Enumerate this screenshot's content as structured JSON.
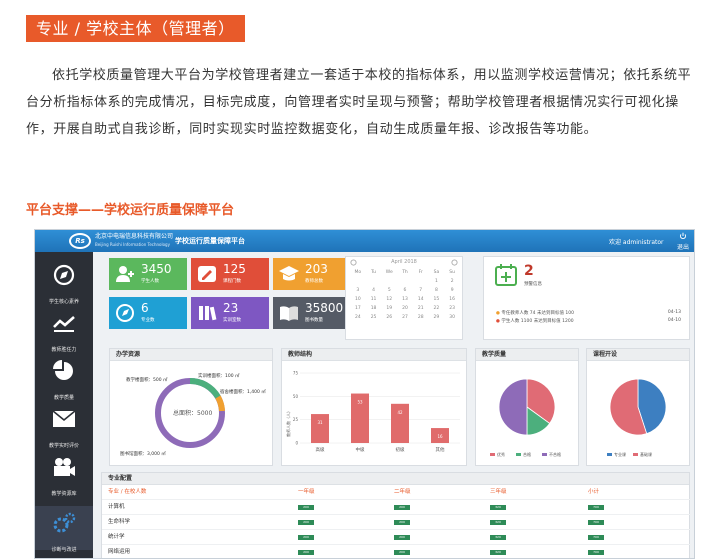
{
  "section_title": "专业 / 学校主体（管理者）",
  "intro_text": "依托学校质量管理大平台为学校管理者建立一套适于本校的指标体系，用以监测学校运营情况；依托系统平台分析指标体系的完成情况，目标完成度，向管理者实时呈现与预警；帮助学校管理者根据情况实行可视化操作，开展自助式自我诊断，同时实现实时监控数据变化，自动生成质量年报、诊改报告等功能。",
  "subhead": "平台支撑——学校运行质量保障平台",
  "dashboard": {
    "logo_mark": "Rs",
    "school_name": "北京中电瑞信息科技有限公司",
    "school_sub": "Beijing Ruishi Information Technology",
    "platform_title": "学校运行质量保障平台",
    "welcome": "欢迎 administrator",
    "exit_label": "退出",
    "sidebar": [
      {
        "label": "学生核心素养",
        "icon": "compass-icon"
      },
      {
        "label": "教师胜任力",
        "icon": "trend-icon"
      },
      {
        "label": "教学质量",
        "icon": "pie-icon"
      },
      {
        "label": "教学实时评价",
        "icon": "envelope-icon"
      },
      {
        "label": "教学资源库",
        "icon": "video-icon"
      },
      {
        "label": "诊断与改进",
        "icon": "gears-icon"
      }
    ],
    "tiles": [
      {
        "num": "3450",
        "label": "学生人数",
        "color": "#5bb85d",
        "icon": "user-add-icon"
      },
      {
        "num": "125",
        "label": "课程门数",
        "color": "#e04e39",
        "icon": "pencil-icon"
      },
      {
        "num": "203",
        "label": "教师总数",
        "color": "#f0a030",
        "icon": "graduation-cap-icon"
      },
      {
        "num": "6",
        "label": "专业数",
        "color": "#1fa0d4",
        "icon": "compass-icon"
      },
      {
        "num": "23",
        "label": "实训室数",
        "color": "#7e57c2",
        "icon": "books-icon"
      },
      {
        "num": "35800",
        "label": "图书数量",
        "color": "#555b66",
        "icon": "book-icon"
      }
    ],
    "calendar": {
      "header": "April 2018",
      "days": [
        "Mo",
        "Tu",
        "We",
        "Th",
        "Fr",
        "Sa",
        "Su",
        "",
        "",
        "",
        "",
        "",
        "1",
        "2",
        "3",
        "4",
        "5",
        "6",
        "7",
        "8",
        "9",
        "10",
        "11",
        "12",
        "13",
        "14",
        "15",
        "16",
        "17",
        "18",
        "19",
        "20",
        "21",
        "22",
        "23",
        "24",
        "25",
        "26",
        "27",
        "28",
        "29",
        "30"
      ]
    },
    "notice": {
      "count": "2",
      "label": "预警信息",
      "lines": [
        {
          "text": "专任教师人数 74 未达到目标值 100",
          "date": "04-13",
          "color": "#f0a030"
        },
        {
          "text": "学生人数 1100 未达到目标值 1200",
          "date": "04-10",
          "color": "#e04e39"
        }
      ]
    },
    "panels": {
      "resources": {
        "title": "办学资源",
        "labels": [
          "教学楼面积：500 ㎡",
          "实训楼面积：100 ㎡",
          "宿舍楼面积：1,400 ㎡",
          "图书馆面积：3,000 ㎡",
          "总面积：5000"
        ]
      },
      "teachers": {
        "title": "教师结构",
        "ylabel": "教师人数（人）",
        "categories": [
          "高级",
          "中级",
          "初级",
          "其他"
        ],
        "values": [
          31,
          53,
          42,
          16
        ],
        "ylim": [
          0,
          75
        ],
        "yticks": [
          0,
          25,
          50,
          75
        ]
      },
      "quality": {
        "title": "教学质量",
        "legend": [
          "优秀",
          "合格",
          "不合格"
        ],
        "slices": [
          {
            "value": 35,
            "color": "#e06b75"
          },
          {
            "value": 15,
            "color": "#4caf7d"
          },
          {
            "value": 50,
            "color": "#8e6bb8"
          }
        ]
      },
      "courses": {
        "title": "课程开设",
        "legend": [
          "专业课",
          "基础课"
        ],
        "slices": [
          {
            "value": 45,
            "color": "#3d7fc1"
          },
          {
            "value": 55,
            "color": "#e06b75"
          }
        ]
      }
    },
    "table": {
      "title": "专业配置",
      "headers": [
        "专业 / 在校人数",
        "一年级",
        "二年级",
        "三年级",
        "小计"
      ],
      "rows": [
        {
          "name": "计算机",
          "vals": [
            "200",
            "200",
            "320",
            "700"
          ]
        },
        {
          "name": "生命科学",
          "vals": [
            "200",
            "200",
            "320",
            "700"
          ]
        },
        {
          "name": "统计学",
          "vals": [
            "200",
            "200",
            "320",
            "700"
          ]
        },
        {
          "name": "网络运用",
          "vals": [
            "200",
            "200",
            "320",
            "700"
          ]
        }
      ]
    }
  }
}
